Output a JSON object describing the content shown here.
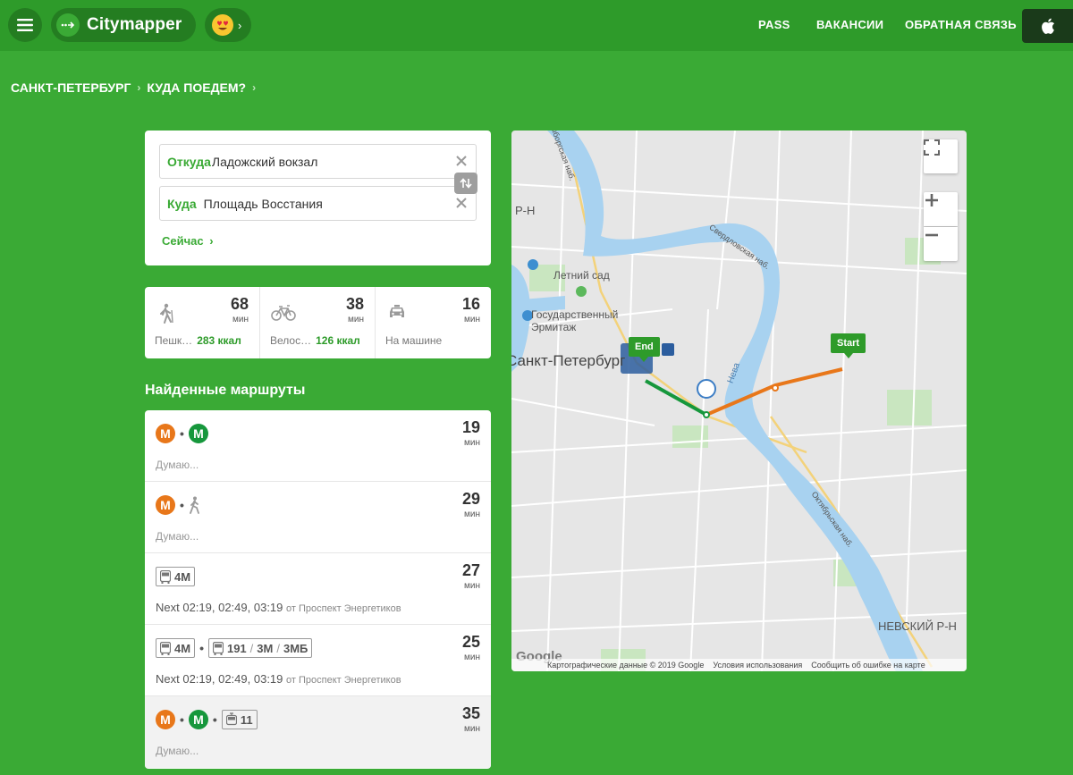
{
  "header": {
    "logo": "Citymapper",
    "nav": [
      "PASS",
      "ВАКАНСИИ",
      "ОБРАТНАЯ СВЯЗЬ"
    ]
  },
  "breadcrumb": [
    "САНКТ-ПЕТЕРБУРГ",
    "КУДА ПОЕДЕМ?"
  ],
  "search": {
    "from_label": "Откуда",
    "from_value": "Ладожский вокзал",
    "to_label": "Куда",
    "to_value": "Площадь Восстания",
    "time_link": "Сейчас"
  },
  "modes": [
    {
      "icon": "walk-icon",
      "time": "68",
      "unit": "мин",
      "label": "Пешк…",
      "kcal": "283 ккал"
    },
    {
      "icon": "bike-icon",
      "time": "38",
      "unit": "мин",
      "label": "Велос…",
      "kcal": "126 ккал"
    },
    {
      "icon": "car-icon",
      "time": "16",
      "unit": "мин",
      "label": "На машине",
      "kcal": ""
    }
  ],
  "routes_title": "Найденные маршруты",
  "routes": [
    {
      "time": "19",
      "unit": "мин",
      "sub": "Думаю..."
    },
    {
      "time": "29",
      "unit": "мин",
      "sub": "Думаю..."
    },
    {
      "time": "27",
      "unit": "мин",
      "bus": "4M",
      "next": "Next 02:19, 02:49, 03:19",
      "from": "от Проспект Энергетиков"
    },
    {
      "time": "25",
      "unit": "мин",
      "bus": "4M",
      "bus2": [
        "191",
        "3M",
        "3MБ"
      ],
      "next": "Next 02:19, 02:49, 03:19",
      "from": "от Проспект Энергетиков"
    },
    {
      "time": "35",
      "unit": "мин",
      "bus": "11",
      "sub": "Думаю..."
    }
  ],
  "map": {
    "labels": {
      "rn": "Р-Н",
      "letniy": "Летний сад",
      "hermitage1": "Государственный",
      "hermitage2": "Эрмитаж",
      "spb": "Санкт-Петербург",
      "neva": "Нева",
      "nevsky": "НЕВСКИЙ Р-Н",
      "sverd": "Свердловская наб.",
      "oktyab": "Октябрьская наб.",
      "vyborg": "Выборгская наб."
    },
    "pin_end": "End",
    "pin_start": "Start",
    "google": "Google",
    "footer": [
      "Картографические данные © 2019 Google",
      "Условия использования",
      "Сообщить об ошибке на карте"
    ]
  },
  "colors": {
    "brand": "#3aaa35",
    "metro_orange": "#e8771a",
    "metro_green": "#16973c"
  }
}
